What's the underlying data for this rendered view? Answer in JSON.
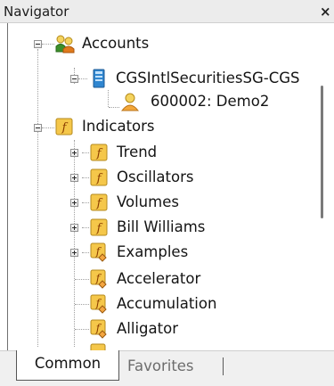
{
  "window": {
    "title": "Navigator",
    "close_label": "×"
  },
  "tree": {
    "accounts": {
      "label": "Accounts",
      "icon": "accounts-icon"
    },
    "server": {
      "label": "CGSIntlSecuritiesSG-CGS",
      "icon": "server-icon"
    },
    "account": {
      "label": "600002: Demo2",
      "icon": "user-account-icon"
    },
    "indicators": {
      "label": "Indicators",
      "icon": "indicator-folder-icon"
    },
    "indicator_items": [
      {
        "label": "Trend",
        "icon": "indicator-folder-icon"
      },
      {
        "label": "Oscillators",
        "icon": "indicator-folder-icon"
      },
      {
        "label": "Volumes",
        "icon": "indicator-folder-icon"
      },
      {
        "label": "Bill Williams",
        "icon": "indicator-folder-icon"
      },
      {
        "label": "Examples",
        "icon": "custom-indicator-icon"
      },
      {
        "label": "Accelerator",
        "icon": "custom-indicator-icon"
      },
      {
        "label": "Accumulation",
        "icon": "custom-indicator-icon"
      },
      {
        "label": "Alligator",
        "icon": "custom-indicator-icon"
      }
    ]
  },
  "tabs": {
    "common": "Common",
    "favorites": "Favorites"
  },
  "colors": {
    "indicator_icon_fill": "#f5c74a",
    "accounts_green": "#3c8f2a",
    "accounts_orange": "#e07a1c",
    "server_blue": "#2f86d0"
  }
}
